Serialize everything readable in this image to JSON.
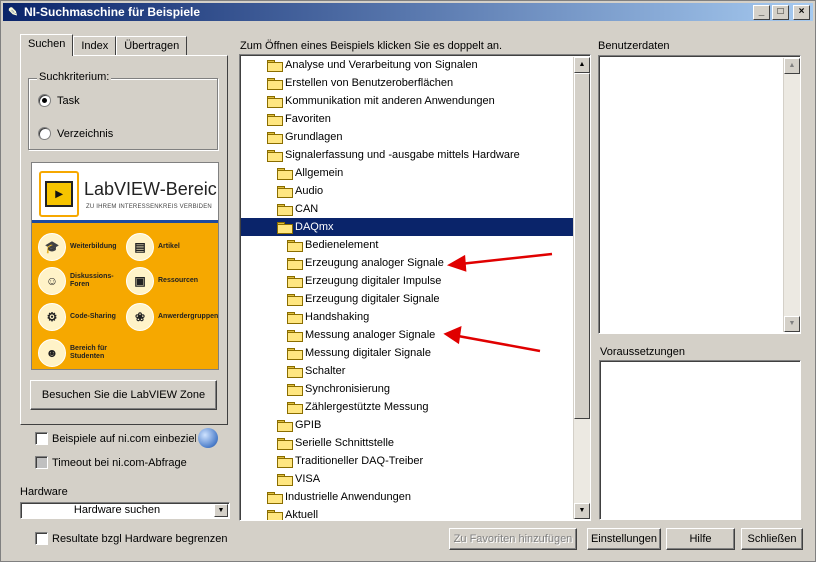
{
  "window": {
    "title": "NI-Suchmaschine für Beispiele"
  },
  "tabs": [
    "Suchen",
    "Index",
    "Übertragen"
  ],
  "search_criterion": {
    "legend": "Suchkriterium:",
    "options": [
      {
        "label": "Task",
        "selected": true
      },
      {
        "label": "Verzeichnis",
        "selected": false
      }
    ]
  },
  "banner": {
    "title": "LabVIEW-Bereich",
    "subtitle": "ZU IHREM INTERESSENKREIS VERBIDEN",
    "items": [
      {
        "label": "Weiterbildung",
        "icon": "graduation-cap-icon"
      },
      {
        "label": "Artikel",
        "icon": "document-icon"
      },
      {
        "label": "Diskussions-\nForen",
        "icon": "chat-bubble-icon"
      },
      {
        "label": "Ressourcen",
        "icon": "box-icon"
      },
      {
        "label": "Code-Sharing",
        "icon": "gears-icon"
      },
      {
        "label": "Anwerdergruppen",
        "icon": "people-icon"
      },
      {
        "label": "Bereich für\nStudenten",
        "icon": "student-icon"
      }
    ]
  },
  "visit_zone_button": "Besuchen Sie die LabVIEW Zone",
  "checkboxes": {
    "include_ni": "Beispiele auf ni.com einbeziehen",
    "timeout": "Timeout bei ni.com-Abfrage"
  },
  "hardware": {
    "label": "Hardware",
    "select_value": "Hardware suchen",
    "limit_checkbox": "Resultate bzgl Hardware begrenzen"
  },
  "tree": {
    "caption": "Zum Öffnen eines Beispiels klicken Sie es doppelt an.",
    "items": [
      {
        "label": "Analyse und Verarbeitung von Signalen",
        "level": 0
      },
      {
        "label": "Erstellen von Benutzeroberflächen",
        "level": 0
      },
      {
        "label": "Kommunikation mit anderen Anwendungen",
        "level": 0
      },
      {
        "label": "Favoriten",
        "level": 0
      },
      {
        "label": "Grundlagen",
        "level": 0
      },
      {
        "label": "Signalerfassung und -ausgabe mittels Hardware",
        "level": 0,
        "open": true
      },
      {
        "label": "Allgemein",
        "level": 1
      },
      {
        "label": "Audio",
        "level": 1
      },
      {
        "label": "CAN",
        "level": 1
      },
      {
        "label": "DAQmx",
        "level": 1,
        "open": true,
        "selected": true
      },
      {
        "label": "Bedienelement",
        "level": 2
      },
      {
        "label": "Erzeugung analoger Signale",
        "level": 2
      },
      {
        "label": "Erzeugung digitaler Impulse",
        "level": 2
      },
      {
        "label": "Erzeugung digitaler Signale",
        "level": 2
      },
      {
        "label": "Handshaking",
        "level": 2
      },
      {
        "label": "Messung analoger Signale",
        "level": 2
      },
      {
        "label": "Messung digitaler Signale",
        "level": 2
      },
      {
        "label": "Schalter",
        "level": 2
      },
      {
        "label": "Synchronisierung",
        "level": 2
      },
      {
        "label": "Zählergestützte Messung",
        "level": 2
      },
      {
        "label": "GPIB",
        "level": 1
      },
      {
        "label": "Serielle Schnittstelle",
        "level": 1
      },
      {
        "label": "Traditioneller DAQ-Treiber",
        "level": 1
      },
      {
        "label": "VISA",
        "level": 1
      },
      {
        "label": "Industrielle Anwendungen",
        "level": 0
      },
      {
        "label": "Aktuell",
        "level": 0
      }
    ]
  },
  "panels": {
    "user_data": "Benutzerdaten",
    "prerequisites": "Voraussetzungen"
  },
  "buttons": {
    "add_favorite": "Zu Favoriten hinzufügen",
    "settings": "Einstellungen",
    "help": "Hilfe",
    "close": "Schließen"
  },
  "colors": {
    "selection": "#0a246a",
    "annotation_arrow": "#e00000",
    "banner": "#f6a800"
  }
}
